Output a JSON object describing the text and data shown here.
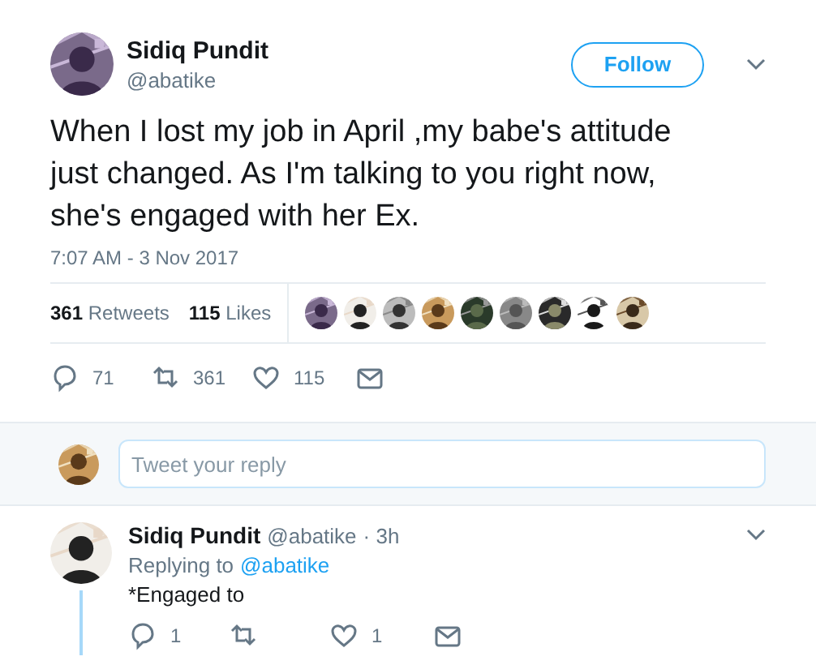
{
  "tweet": {
    "author": "Sidiq Pundit",
    "handle": "@abatike",
    "follow_label": "Follow",
    "text": "When I lost my job in April ,my babe's attitude just changed. As I'm talking to you right now, she's engaged with her Ex.",
    "timestamp": "7:07 AM - 3 Nov 2017",
    "stats": [
      {
        "count": "361",
        "label": "Retweets"
      },
      {
        "count": "115",
        "label": "Likes"
      }
    ],
    "actions": [
      {
        "kind": "reply",
        "count": "71"
      },
      {
        "kind": "retweet",
        "count": "361"
      },
      {
        "kind": "like",
        "count": "115"
      },
      {
        "kind": "message"
      }
    ]
  },
  "reply_box": {
    "placeholder": "Tweet your reply"
  },
  "replies": [
    {
      "author": "Sidiq Pundit",
      "handle": "@abatike",
      "time": "· 3h",
      "replying_prefix": "Replying to",
      "replying_to": "@abatike",
      "text": "*Engaged to",
      "actions": [
        {
          "kind": "reply",
          "count": "1"
        },
        {
          "kind": "retweet"
        },
        {
          "kind": "like",
          "count": "1"
        },
        {
          "kind": "message"
        }
      ]
    }
  ]
}
